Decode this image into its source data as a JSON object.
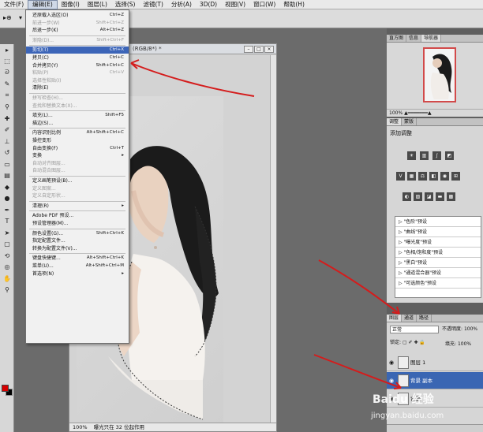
{
  "menubar": {
    "items": [
      "文件(F)",
      "编辑(E)",
      "图像(I)",
      "图层(L)",
      "选择(S)",
      "滤镜(T)",
      "分析(A)",
      "3D(D)",
      "视图(V)",
      "窗口(W)",
      "帮助(H)"
    ]
  },
  "document": {
    "title": "(RGB/8*) *",
    "zoom": "100%",
    "status": "曝光只在 32 位起作用"
  },
  "edit_menu": {
    "items": [
      {
        "label": "还原载入选区(O)",
        "shortcut": "Ctrl+Z",
        "disabled": false
      },
      {
        "label": "前进一步(W)",
        "shortcut": "Shift+Ctrl+Z",
        "disabled": true
      },
      {
        "label": "后退一步(K)",
        "shortcut": "Alt+Ctrl+Z",
        "disabled": false
      },
      {
        "sep": true
      },
      {
        "label": "渐隐(D)...",
        "shortcut": "Shift+Ctrl+F",
        "disabled": true
      },
      {
        "sep": true
      },
      {
        "label": "剪切(T)",
        "shortcut": "Ctrl+X",
        "disabled": false,
        "highlight": true
      },
      {
        "label": "拷贝(C)",
        "shortcut": "Ctrl+C",
        "disabled": false
      },
      {
        "label": "合并拷贝(Y)",
        "shortcut": "Shift+Ctrl+C",
        "disabled": false
      },
      {
        "label": "粘贴(P)",
        "shortcut": "Ctrl+V",
        "disabled": true
      },
      {
        "label": "选择性粘贴(I)",
        "shortcut": "",
        "disabled": true
      },
      {
        "label": "清除(E)",
        "shortcut": "",
        "disabled": false
      },
      {
        "sep": true
      },
      {
        "label": "拼写检查(H)...",
        "shortcut": "",
        "disabled": true
      },
      {
        "label": "查找和替换文本(X)...",
        "shortcut": "",
        "disabled": true
      },
      {
        "sep": true
      },
      {
        "label": "填充(L)...",
        "shortcut": "Shift+F5",
        "disabled": false
      },
      {
        "label": "描边(S)...",
        "shortcut": "",
        "disabled": false
      },
      {
        "sep": true
      },
      {
        "label": "内容识别比例",
        "shortcut": "Alt+Shift+Ctrl+C",
        "disabled": false
      },
      {
        "label": "操控变形",
        "shortcut": "",
        "disabled": false
      },
      {
        "label": "自由变换(F)",
        "shortcut": "Ctrl+T",
        "disabled": false
      },
      {
        "label": "变换",
        "shortcut": "▸",
        "disabled": false
      },
      {
        "label": "自动对齐图层...",
        "shortcut": "",
        "disabled": true
      },
      {
        "label": "自动混合图层...",
        "shortcut": "",
        "disabled": true
      },
      {
        "sep": true
      },
      {
        "label": "定义画笔预设(B)...",
        "shortcut": "",
        "disabled": false
      },
      {
        "label": "定义图案...",
        "shortcut": "",
        "disabled": true
      },
      {
        "label": "定义自定形状...",
        "shortcut": "",
        "disabled": true
      },
      {
        "sep": true
      },
      {
        "label": "清理(R)",
        "shortcut": "▸",
        "disabled": false
      },
      {
        "sep": true
      },
      {
        "label": "Adobe PDF 预设...",
        "shortcut": "",
        "disabled": false
      },
      {
        "label": "预设管理器(M)...",
        "shortcut": "",
        "disabled": false
      },
      {
        "sep": true
      },
      {
        "label": "颜色设置(G)...",
        "shortcut": "Shift+Ctrl+K",
        "disabled": false
      },
      {
        "label": "指定配置文件...",
        "shortcut": "",
        "disabled": false
      },
      {
        "label": "转换为配置文件(V)...",
        "shortcut": "",
        "disabled": false
      },
      {
        "sep": true
      },
      {
        "label": "键盘快捷键...",
        "shortcut": "Alt+Shift+Ctrl+K",
        "disabled": false
      },
      {
        "label": "菜单(U)...",
        "shortcut": "Alt+Shift+Ctrl+M",
        "disabled": false
      },
      {
        "label": "首选项(N)",
        "shortcut": "▸",
        "disabled": false
      }
    ]
  },
  "navigator": {
    "tabs": [
      "直方图",
      "信息",
      "导航器"
    ],
    "zoom": "100%"
  },
  "adjustments": {
    "tabs": [
      "调整",
      "蒙版"
    ],
    "title": "添加调整",
    "presets": [
      "\"色阶\"预设",
      "\"曲线\"预设",
      "\"曝光度\"预设",
      "\"色相/饱和度\"预设",
      "\"黑白\"预设",
      "\"通道混合器\"预设",
      "\"可选颜色\"预设"
    ]
  },
  "layers": {
    "tabs": [
      "图层",
      "通道",
      "路径"
    ],
    "blend_mode": "正常",
    "opacity_label": "不透明度:",
    "opacity": "100%",
    "lock_label": "锁定:",
    "fill_label": "填充:",
    "fill": "100%",
    "items": [
      {
        "name": "图层 1",
        "selected": false
      },
      {
        "name": "背景 副本",
        "selected": true
      },
      {
        "name": "背景",
        "selected": false
      }
    ]
  },
  "watermark": {
    "brand": "Baidu 经验",
    "url": "jingyan.baidu.com"
  },
  "colors": {
    "foreground": "#d50000",
    "background": "#000000",
    "menu_highlight": "#3c65b8",
    "annotation_arrow": "#d41c1c"
  }
}
